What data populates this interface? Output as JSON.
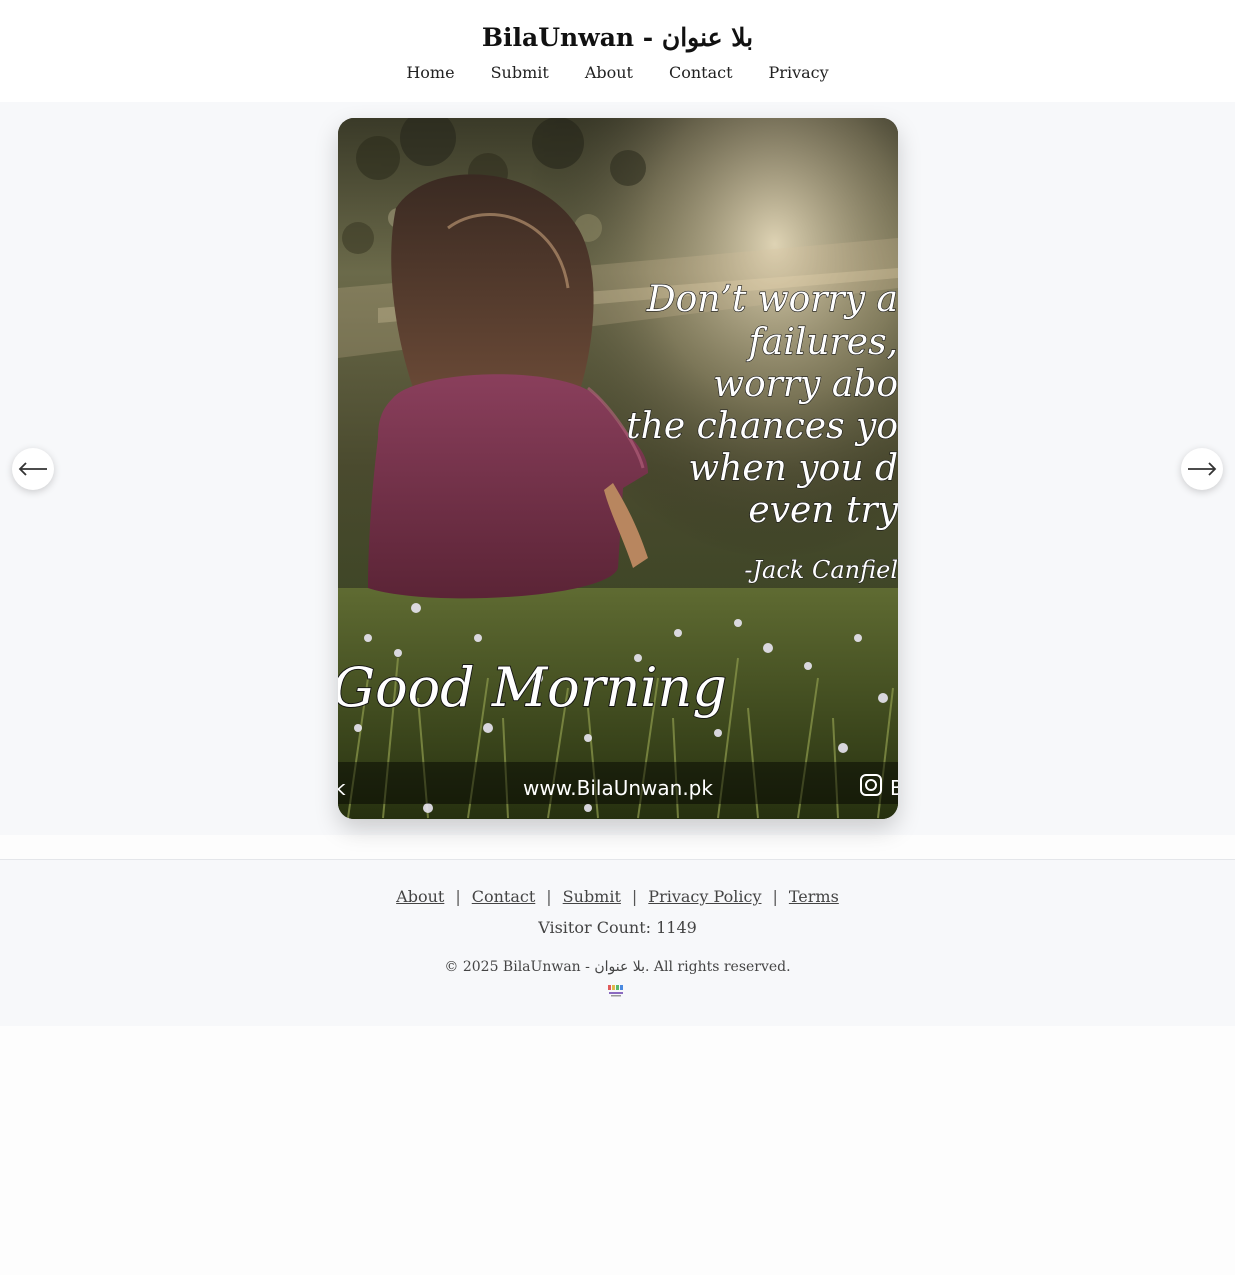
{
  "header": {
    "title": "BilaUnwan - بلا عنوان",
    "nav": [
      "Home",
      "Submit",
      "About",
      "Contact",
      "Privacy"
    ]
  },
  "slider": {
    "image": {
      "quote_lines": [
        "Don’t worry a",
        "failures,",
        "worry abo",
        "the chances yo",
        "when you d",
        "even try"
      ],
      "attribution": "-Jack Canfiel",
      "greeting": "Good Morning",
      "website": "www.BilaUnwan.pk",
      "left_fragment": "k",
      "right_fragment": "B"
    },
    "prev_icon": "arrow-left-icon",
    "next_icon": "arrow-right-icon"
  },
  "footer": {
    "links": [
      "About",
      "Contact",
      "Submit",
      "Privacy Policy",
      "Terms"
    ],
    "separator": "|",
    "visitor_count": "Visitor Count: 1149",
    "copyright": "© 2025 BilaUnwan - بلا عنوان. All rights reserved.",
    "logo": "bilaunwan-logo"
  },
  "colors": {
    "page_bg": "#f7f8fa",
    "header_bg": "#ffffff",
    "text": "#222222",
    "footer_text": "#444444"
  }
}
